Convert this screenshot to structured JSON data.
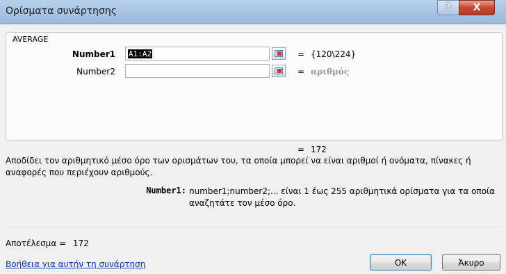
{
  "window": {
    "title": "Ορίσματα συνάρτησης",
    "help_glyph": "?",
    "close_glyph": "X"
  },
  "function": {
    "name": "AVERAGE"
  },
  "args": [
    {
      "label": "Number1",
      "input": "A1:A2",
      "equals": "=",
      "value": "{120\\224}"
    },
    {
      "label": "Number2",
      "input": "",
      "equals": "=",
      "value": "αριθμός"
    }
  ],
  "result_preview": {
    "equals": "=",
    "value": "172"
  },
  "description": "Αποδίδει τον αριθμητικό μέσο όρο των ορισμάτων του, τα οποία μπορεί να είναι αριθμοί ή ονόματα, πίνακες ή αναφορές που περιέχουν αριθμούς.",
  "arg_help": {
    "name": "Number1:",
    "text": "number1;number2;... είναι 1 έως 255 αριθμητικά ορίσματα για τα οποία αναζητάτε τον μέσο όρο."
  },
  "formula_result": {
    "label": "Αποτέλεσμα =",
    "value": "172"
  },
  "help_link": "Βοήθεια για αυτήν τη συνάρτηση",
  "buttons": {
    "ok": "OK",
    "cancel": "Άκυρο"
  },
  "icons": {
    "cursor": "mouse-pointer-icon",
    "ref": "collapse-dialog-icon"
  }
}
